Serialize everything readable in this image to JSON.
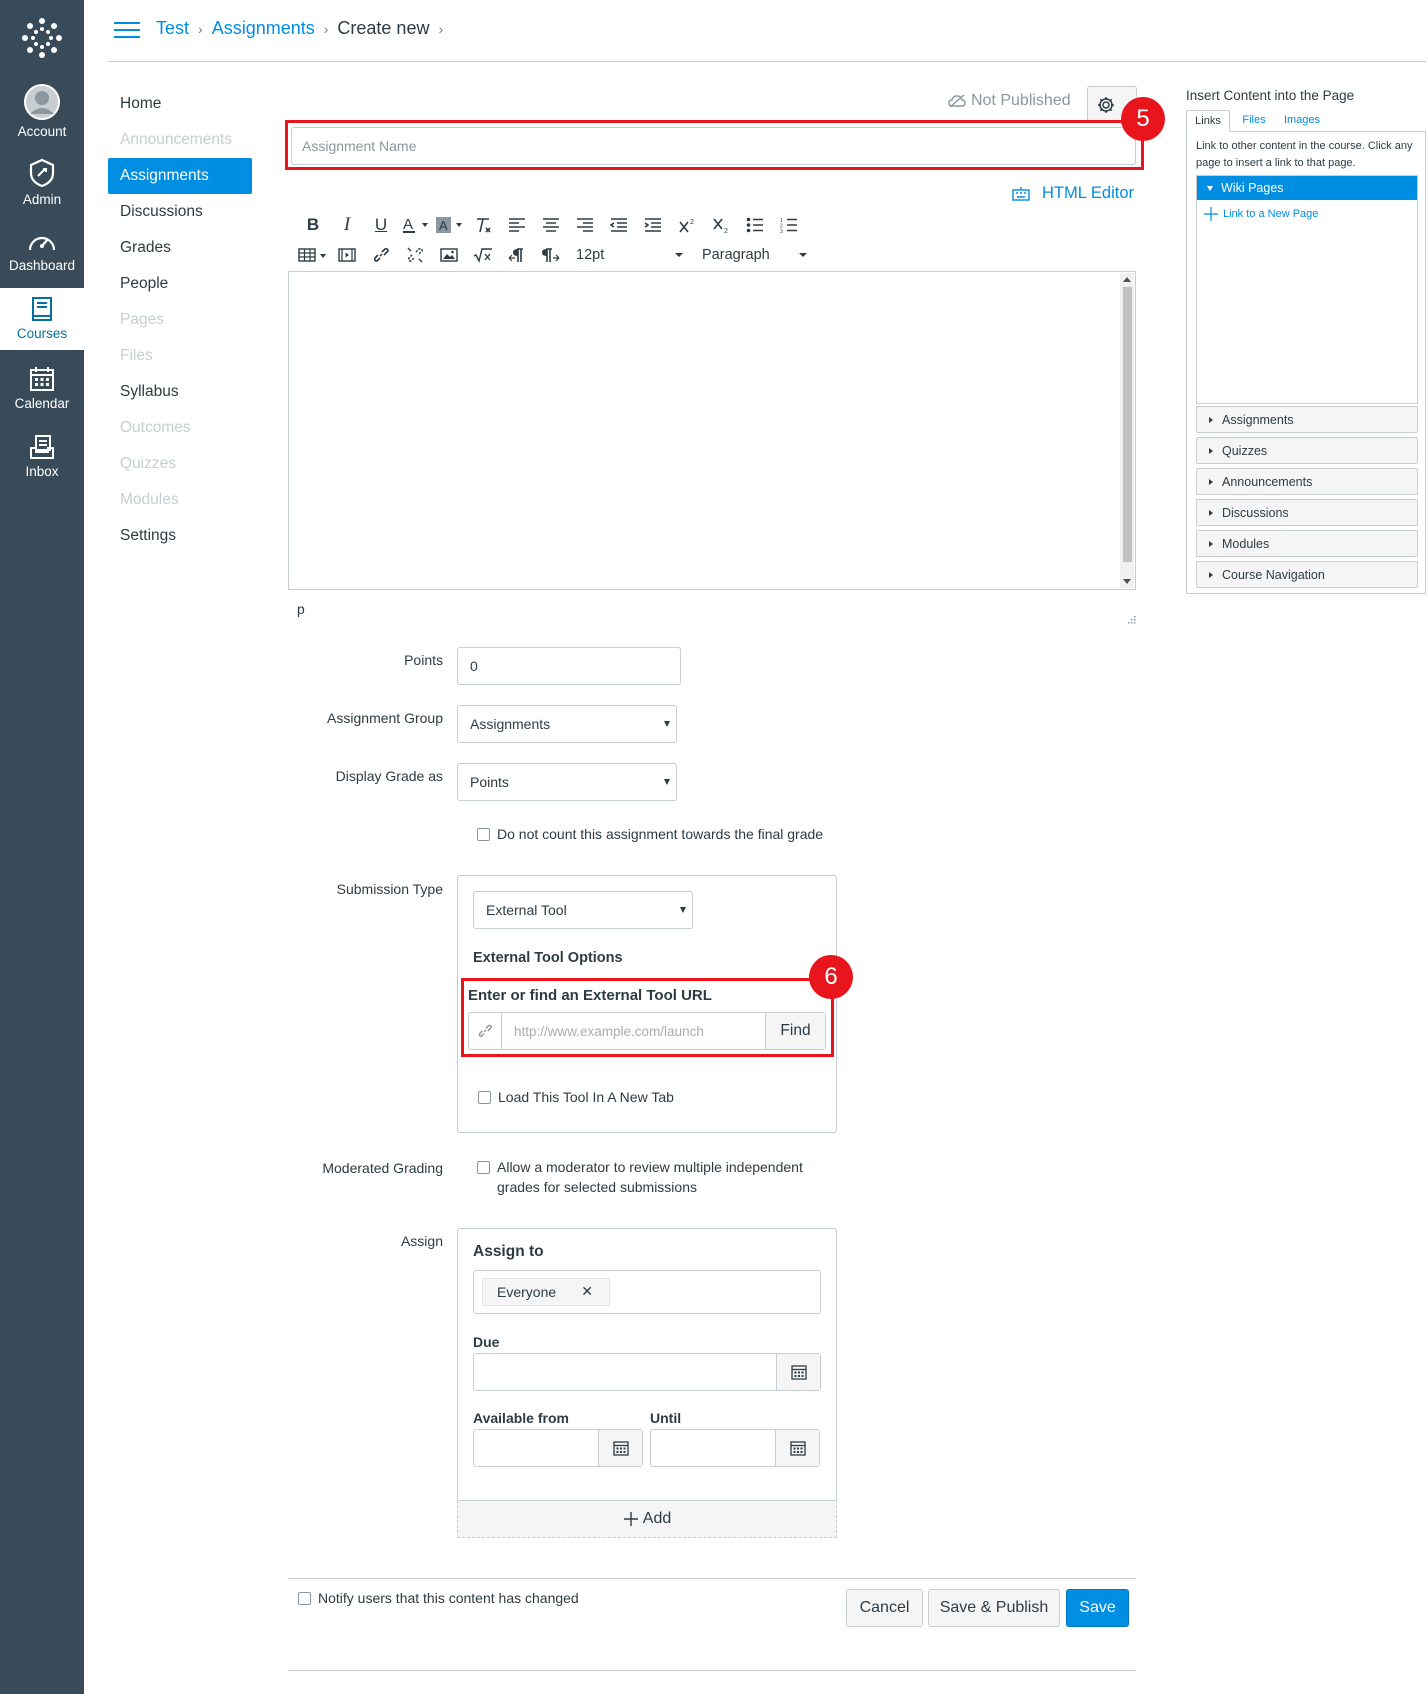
{
  "global_nav": {
    "account": "Account",
    "admin": "Admin",
    "dashboard": "Dashboard",
    "courses": "Courses",
    "calendar": "Calendar",
    "inbox": "Inbox"
  },
  "breadcrumb": {
    "course": "Test",
    "section": "Assignments",
    "current": "Create new"
  },
  "course_nav": [
    "Home",
    "Announcements",
    "Assignments",
    "Discussions",
    "Grades",
    "People",
    "Pages",
    "Files",
    "Syllabus",
    "Outcomes",
    "Quizzes",
    "Modules",
    "Settings"
  ],
  "header": {
    "publish_status": "Not Published",
    "name_placeholder": "Assignment Name",
    "html_editor": "HTML Editor"
  },
  "annotations": {
    "first": "5",
    "second": "6"
  },
  "toolbar": {
    "bold": "B",
    "italic": "I",
    "underline": "U",
    "font_size": "12pt",
    "format": "Paragraph"
  },
  "editor": {
    "path": "p"
  },
  "form": {
    "points_label": "Points",
    "points_value": "0",
    "group_label": "Assignment Group",
    "group_value": "Assignments",
    "display_label": "Display Grade as",
    "display_value": "Points",
    "omit_label": "Do not count this assignment towards the final grade",
    "submission_label": "Submission Type",
    "submission_value": "External Tool",
    "tool_options": "External Tool Options",
    "url_label": "Enter or find an External Tool URL",
    "url_placeholder": "http://www.example.com/launch",
    "find": "Find",
    "new_tab": "Load This Tool In A New Tab",
    "moderated_label": "Moderated Grading",
    "moderated_text_1": "Allow a moderator to review multiple independent",
    "moderated_text_2": "grades for selected submissions",
    "assign_label": "Assign",
    "assign_to": "Assign to",
    "everyone": "Everyone",
    "remove": "✕",
    "due": "Due",
    "available_from": "Available from",
    "until": "Until",
    "add": "Add"
  },
  "footer": {
    "notify": "Notify users that this content has changed",
    "cancel": "Cancel",
    "save_publish": "Save & Publish",
    "save": "Save"
  },
  "sidebar": {
    "title": "Insert Content into the Page",
    "tabs": [
      "Links",
      "Files",
      "Images"
    ],
    "description": "Link to other content in the course. Click any page to insert a link to that page.",
    "wiki_pages": "Wiki Pages",
    "new_page": "Link to a New Page",
    "sections": [
      "Assignments",
      "Quizzes",
      "Announcements",
      "Discussions",
      "Modules",
      "Course Navigation"
    ]
  },
  "colors": {
    "accent": "#008ee2",
    "nav_bg": "#394b58",
    "highlight": "#e8151d"
  }
}
